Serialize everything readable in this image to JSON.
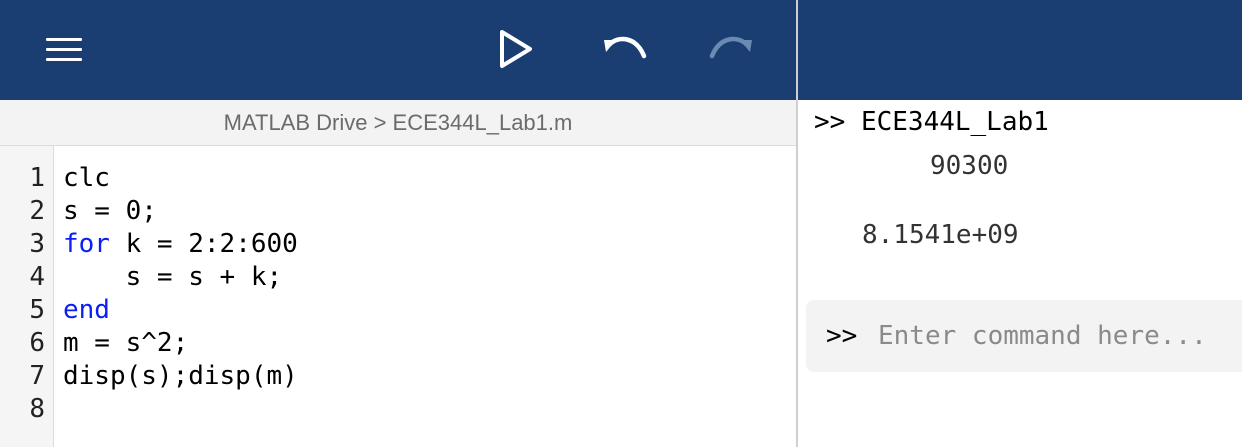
{
  "toolbar": {
    "icons": {
      "menu": "hamburger-menu-icon",
      "run": "play-icon",
      "undo": "undo-icon",
      "redo": "redo-icon"
    },
    "redo_enabled": false
  },
  "breadcrumb": {
    "text": "MATLAB Drive > ECE344L_Lab1.m"
  },
  "editor": {
    "lines": [
      {
        "number": "1",
        "code": "clc"
      },
      {
        "number": "2",
        "code": "s = 0;"
      },
      {
        "number": "3",
        "keyword": "for",
        "code": " k = 2:2:600"
      },
      {
        "number": "4",
        "code": "    s = s + k;"
      },
      {
        "number": "5",
        "keyword": "end",
        "code": ""
      },
      {
        "number": "6",
        "code": "m = s^2;"
      },
      {
        "number": "7",
        "code": "disp(s);disp(m)"
      },
      {
        "number": "8",
        "code": ""
      }
    ]
  },
  "command_window": {
    "last_command": ">> ECE344L_Lab1",
    "outputs": [
      "90300",
      "8.1541e+09"
    ],
    "prompt": ">>",
    "input_value": "",
    "input_placeholder": "Enter command here..."
  },
  "colors": {
    "toolbar_bg": "#1b3e72",
    "keyword": "#0a1ef5",
    "redo_disabled": "#6a8ab3"
  }
}
